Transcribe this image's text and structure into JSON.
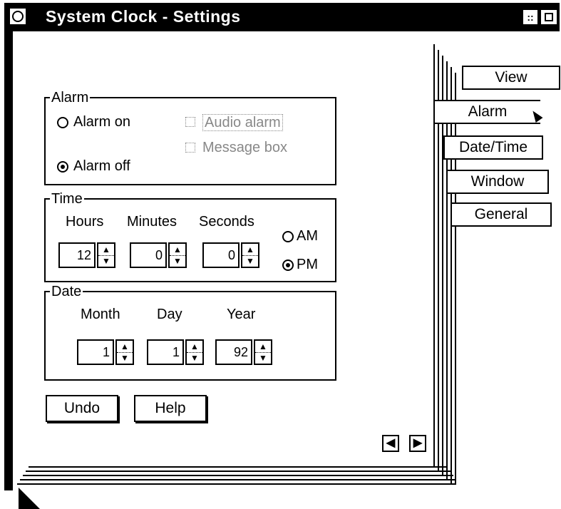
{
  "window": {
    "title": "System Clock - Settings",
    "min_glyph": "::",
    "sysmenu_glyph": "<"
  },
  "alarm": {
    "group_label": "Alarm",
    "alarm_on_label": "Alarm on",
    "alarm_off_label": "Alarm off",
    "alarm_selected": "off",
    "audio_alarm_label": "Audio alarm",
    "message_box_label": "Message box"
  },
  "time": {
    "group_label": "Time",
    "hours_label": "Hours",
    "minutes_label": "Minutes",
    "seconds_label": "Seconds",
    "hours_value": "12",
    "minutes_value": "0",
    "seconds_value": "0",
    "am_label": "AM",
    "pm_label": "PM",
    "ampm_selected": "PM"
  },
  "date": {
    "group_label": "Date",
    "month_label": "Month",
    "day_label": "Day",
    "year_label": "Year",
    "month_value": "1",
    "day_value": "1",
    "year_value": "92"
  },
  "buttons": {
    "undo_label": "Undo",
    "help_label": "Help"
  },
  "tabs": {
    "view": "View",
    "alarm": "Alarm",
    "date_time": "Date/Time",
    "window": "Window",
    "general": "General",
    "active": "Alarm"
  },
  "page_nav": {
    "prev_glyph": "◀",
    "next_glyph": "▶"
  },
  "spin": {
    "up_glyph": "▲",
    "down_glyph": "▼"
  }
}
